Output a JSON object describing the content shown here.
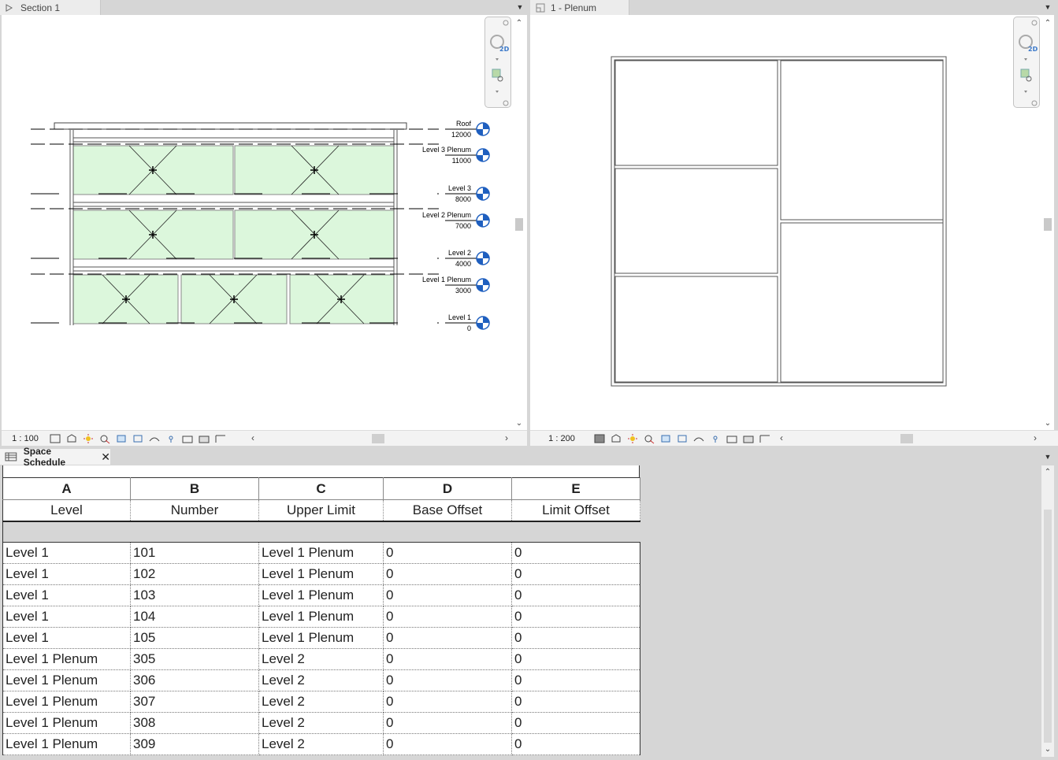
{
  "left_view": {
    "tab_title": "Section 1",
    "scale": "1 : 100",
    "levels": [
      {
        "name": "Roof",
        "elevation": "12000"
      },
      {
        "name": "Level 3 Plenum",
        "elevation": "11000"
      },
      {
        "name": "Level 3",
        "elevation": "8000"
      },
      {
        "name": "Level 2 Plenum",
        "elevation": "7000"
      },
      {
        "name": "Level 2",
        "elevation": "4000"
      },
      {
        "name": "Level 1 Plenum",
        "elevation": "3000"
      },
      {
        "name": "Level 1",
        "elevation": "0"
      }
    ]
  },
  "right_view": {
    "tab_title": "1 - Plenum",
    "scale": "1 : 200"
  },
  "schedule": {
    "tab_title": "Space Schedule",
    "column_letters": [
      "A",
      "B",
      "C",
      "D",
      "E"
    ],
    "column_headers": [
      "Level",
      "Number",
      "Upper Limit",
      "Base Offset",
      "Limit Offset"
    ],
    "rows": [
      [
        "Level 1",
        "101",
        "Level 1 Plenum",
        "0",
        "0"
      ],
      [
        "Level 1",
        "102",
        "Level 1 Plenum",
        "0",
        "0"
      ],
      [
        "Level 1",
        "103",
        "Level 1 Plenum",
        "0",
        "0"
      ],
      [
        "Level 1",
        "104",
        "Level 1 Plenum",
        "0",
        "0"
      ],
      [
        "Level 1",
        "105",
        "Level 1 Plenum",
        "0",
        "0"
      ],
      [
        "Level 1 Plenum",
        "305",
        "Level 2",
        "0",
        "0"
      ],
      [
        "Level 1 Plenum",
        "306",
        "Level 2",
        "0",
        "0"
      ],
      [
        "Level 1 Plenum",
        "307",
        "Level 2",
        "0",
        "0"
      ],
      [
        "Level 1 Plenum",
        "308",
        "Level 2",
        "0",
        "0"
      ],
      [
        "Level 1 Plenum",
        "309",
        "Level 2",
        "0",
        "0"
      ]
    ]
  },
  "colors": {
    "space_fill": "#dcf7dc",
    "level_head_blue": "#1f5fbf",
    "chrome_gray": "#d6d6d6"
  },
  "icons": {
    "section_tab": "section-view-icon",
    "plan_tab": "plan-view-icon",
    "schedule_tab": "schedule-icon",
    "close": "close-icon"
  }
}
